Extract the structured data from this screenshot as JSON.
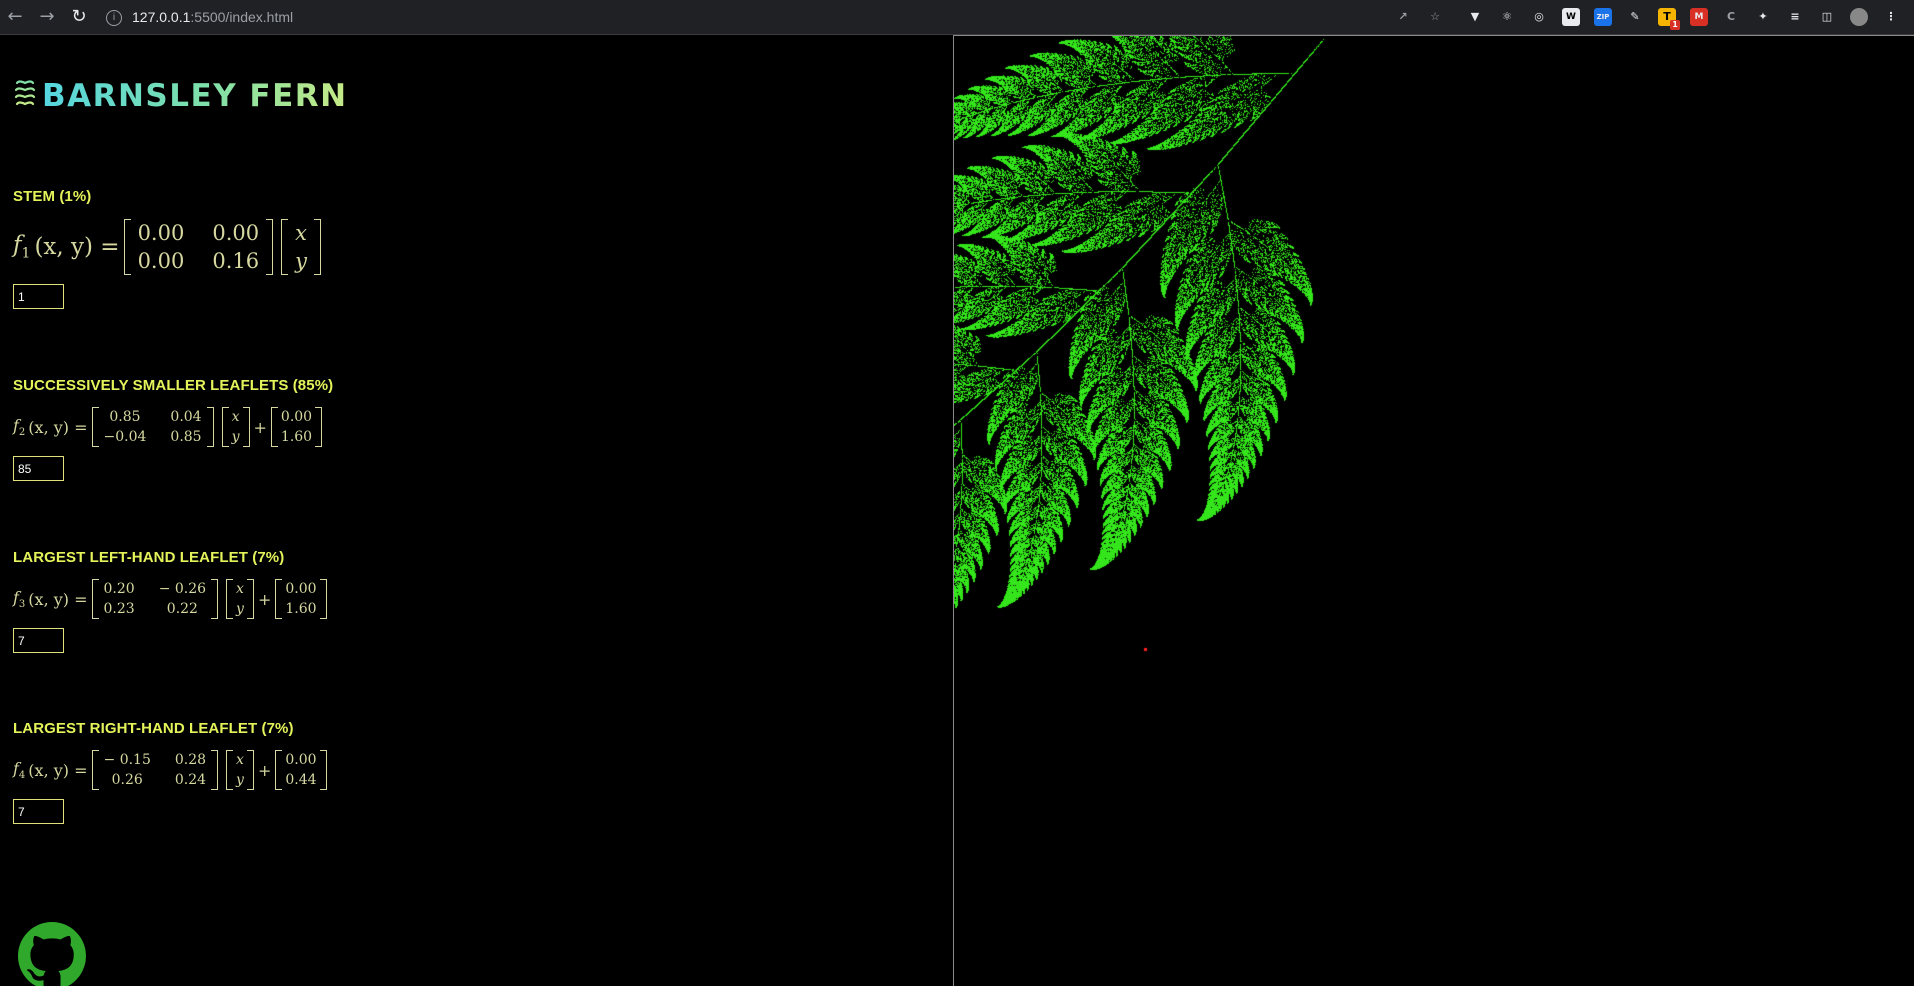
{
  "browser": {
    "url_host": "127.0.0.1",
    "url_path": ":5500/index.html",
    "back_icon": "arrow-left-icon",
    "forward_icon": "arrow-right-icon",
    "reload_icon": "reload-icon",
    "extension_badge": "1"
  },
  "logo": {
    "text": "BARNSLEY FERN",
    "icon": "fern-leaf-icon",
    "gradient_colors": [
      "#55d6e0",
      "#c6ea86"
    ]
  },
  "sections": [
    {
      "heading": "STEM (1%)",
      "fname": "f",
      "sub": "1",
      "args": "(x, y) =",
      "matrix": [
        [
          "0.00",
          "0.00"
        ],
        [
          "0.00",
          "0.16"
        ]
      ],
      "vector": [
        "x",
        "y"
      ],
      "offset": null,
      "probability": "1"
    },
    {
      "heading": "SUCCESSIVELY SMALLER LEAFLETS (85%)",
      "fname": "f",
      "sub": "2",
      "args": "(x, y) =",
      "matrix": [
        [
          "0.85",
          "0.04"
        ],
        [
          "−0.04",
          "0.85"
        ]
      ],
      "vector": [
        "x",
        "y"
      ],
      "offset": [
        "0.00",
        "1.60"
      ],
      "probability": "85"
    },
    {
      "heading": "LARGEST LEFT-HAND LEAFLET (7%)",
      "fname": "f",
      "sub": "3",
      "args": "(x, y) =",
      "matrix": [
        [
          "0.20",
          "− 0.26"
        ],
        [
          "0.23",
          "0.22"
        ]
      ],
      "vector": [
        "x",
        "y"
      ],
      "offset": [
        "0.00",
        "1.60"
      ],
      "probability": "7"
    },
    {
      "heading": "LARGEST RIGHT-HAND LEAFLET (7%)",
      "fname": "f",
      "sub": "4",
      "args": "(x, y) =",
      "matrix": [
        [
          "− 0.15",
          "0.28"
        ],
        [
          "0.26",
          "0.24"
        ]
      ],
      "vector": [
        "x",
        "y"
      ],
      "offset": [
        "0.00",
        "0.44"
      ],
      "probability": "7"
    }
  ],
  "canvas": {
    "fern_color": "#33e51a",
    "background": "#000000"
  },
  "footer": {
    "github_icon": "github-icon"
  }
}
